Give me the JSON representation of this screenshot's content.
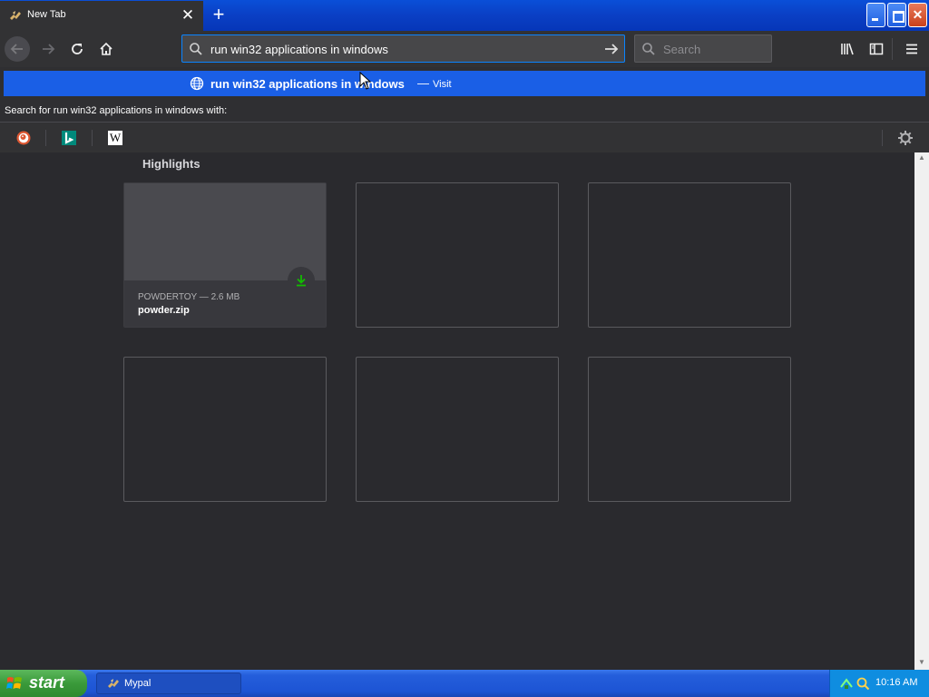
{
  "browser": {
    "tab": {
      "title": "New Tab",
      "close_glyph": "✕",
      "icon": "mypal-icon"
    },
    "new_tab_glyph": "+",
    "window_controls": [
      "minimize",
      "maximize",
      "close"
    ]
  },
  "toolbar": {
    "url_value": "run win32 applications in windows",
    "search_placeholder": "Search"
  },
  "autocomplete": {
    "title": "run win32 applications in windows",
    "separator": "—",
    "action": "Visit",
    "oneoff_header": "Search for run win32 applications in windows with:",
    "engines": [
      "DuckDuckGo",
      "Bing",
      "Wikipedia"
    ],
    "wiki_glyph": "W"
  },
  "content": {
    "section_title": "Highlights",
    "highlight": {
      "meta": "POWDERTOY — 2.6 MB",
      "filename": "powder.zip"
    }
  },
  "taskbar": {
    "start_label": "start",
    "task_label": "Mypal",
    "clock": "10:16 AM"
  },
  "colors": {
    "accent_blue": "#0a84ff",
    "autocomplete_selected": "#1a5fe6",
    "download_green": "#12bc00",
    "page_background": "#2a2a2e"
  }
}
